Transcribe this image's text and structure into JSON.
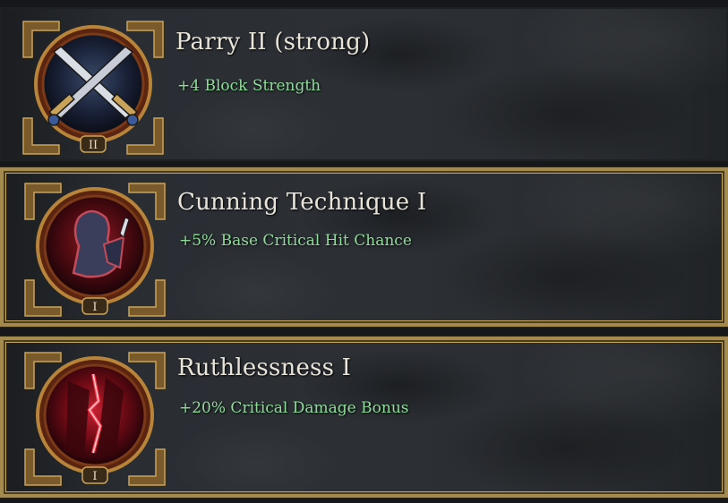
{
  "perks": [
    {
      "title": "Parry II (strong)",
      "effect": "+4 Block Strength",
      "rank": "II",
      "icon": "crossed-swords-icon",
      "selected": false
    },
    {
      "title": "Cunning Technique I",
      "effect": "+5% Base Critical Hit Chance",
      "rank": "I",
      "icon": "rogue-figure-icon",
      "selected": true
    },
    {
      "title": "Ruthlessness I",
      "effect": "+20% Critical Damage Bonus",
      "rank": "I",
      "icon": "blood-strike-icon",
      "selected": true
    }
  ],
  "colors": {
    "title": "#e8e4da",
    "effect": "#8fdc9a",
    "gold_border": "#a48a4c"
  }
}
